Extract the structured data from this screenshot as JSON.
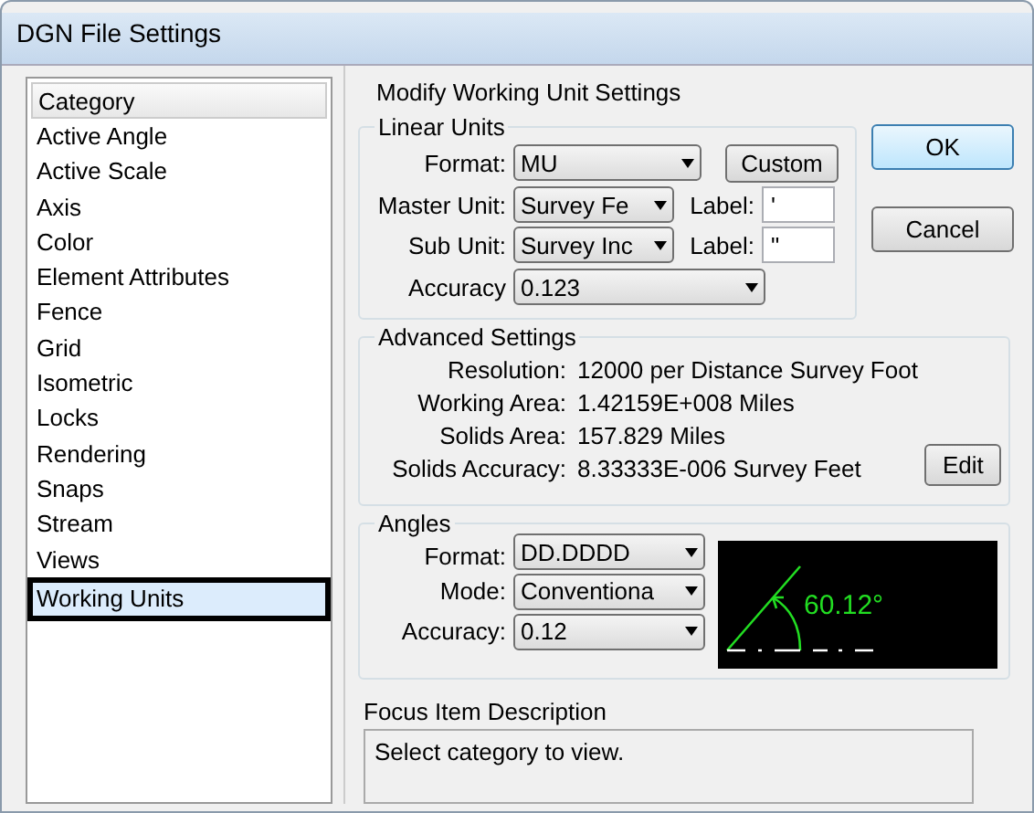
{
  "window": {
    "title": "DGN File Settings"
  },
  "category_list": {
    "header": "Category",
    "items": [
      {
        "label": "Active Angle",
        "selected": false
      },
      {
        "label": "Active Scale",
        "selected": false
      },
      {
        "label": "Axis",
        "selected": false
      },
      {
        "label": "Color",
        "selected": false
      },
      {
        "label": "Element Attributes",
        "selected": false
      },
      {
        "label": "Fence",
        "selected": false
      },
      {
        "label": "Grid",
        "selected": false
      },
      {
        "label": "Isometric",
        "selected": false
      },
      {
        "label": "Locks",
        "selected": false
      },
      {
        "label": "Rendering",
        "selected": false
      },
      {
        "label": "Snaps",
        "selected": false
      },
      {
        "label": "Stream",
        "selected": false
      },
      {
        "label": "Views",
        "selected": false
      },
      {
        "label": "Working Units",
        "selected": true
      }
    ]
  },
  "panel_title": "Modify Working Unit Settings",
  "linear_units": {
    "title": "Linear Units",
    "format_label": "Format:",
    "format_value": "MU",
    "custom_button": "Custom",
    "master_unit_label": "Master Unit:",
    "master_unit_value": "Survey Fe",
    "master_label_label": "Label:",
    "master_label_value": "'",
    "sub_unit_label": "Sub Unit:",
    "sub_unit_value": "Survey Inc",
    "sub_label_label": "Label:",
    "sub_label_value": "\"",
    "accuracy_label": "Accuracy",
    "accuracy_value": "0.123"
  },
  "buttons": [
    "OK",
    "Cancel"
  ],
  "advanced_settings": {
    "title": "Advanced Settings",
    "rows": [
      {
        "label": "Resolution:",
        "value": "12000 per Distance Survey Foot"
      },
      {
        "label": "Working Area:",
        "value": "1.42159E+008 Miles"
      },
      {
        "label": "Solids Area:",
        "value": "157.829 Miles"
      },
      {
        "label": "Solids Accuracy:",
        "value": "8.33333E-006 Survey Feet"
      }
    ],
    "edit_button": "Edit"
  },
  "angles": {
    "title": "Angles",
    "fields": [
      {
        "label": "Format:",
        "value": "DD.DDDD"
      },
      {
        "label": "Mode:",
        "value": "Conventiona"
      },
      {
        "label": "Accuracy:",
        "value": "0.12"
      }
    ],
    "preview_reading": "60.12°"
  },
  "focus_item": {
    "title": "Focus Item Description",
    "text": "Select category to view."
  }
}
